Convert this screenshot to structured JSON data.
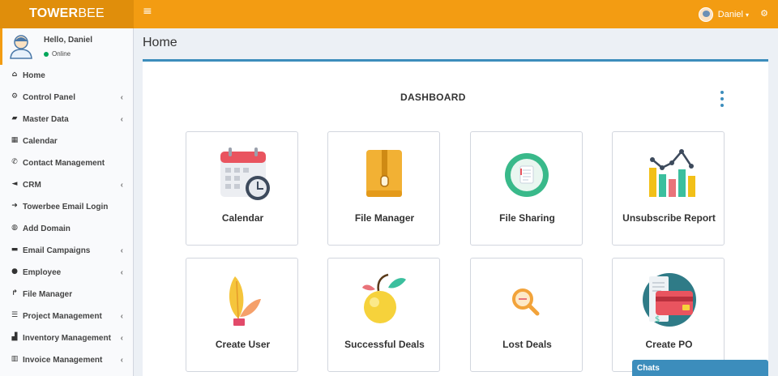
{
  "header": {
    "logo_bold": "TOWER",
    "logo_rest": "BEE",
    "user_name": "Daniel",
    "toggle_glyph": "≡",
    "settings_glyph": "⚙",
    "colors": {
      "bar": "#f39c12",
      "logo_bg": "#e08e0b"
    }
  },
  "sidebar": {
    "greeting": "Hello, Daniel",
    "status": "Online",
    "items": [
      {
        "label": "Home",
        "icon": "home-icon",
        "glyph": "⌂",
        "expandable": false
      },
      {
        "label": "Control Panel",
        "icon": "gear-icon",
        "glyph": "⚙",
        "expandable": true
      },
      {
        "label": "Master Data",
        "icon": "book-icon",
        "glyph": "▰",
        "expandable": true
      },
      {
        "label": "Calendar",
        "icon": "calendar-icon",
        "glyph": "▦",
        "expandable": false
      },
      {
        "label": "Contact Management",
        "icon": "phone-icon",
        "glyph": "✆",
        "expandable": false
      },
      {
        "label": "CRM",
        "icon": "bullhorn-icon",
        "glyph": "◄",
        "expandable": true
      },
      {
        "label": "Towerbee Email Login",
        "icon": "sign-in-icon",
        "glyph": "➜",
        "expandable": false
      },
      {
        "label": "Add Domain",
        "icon": "globe-icon",
        "glyph": "◍",
        "expandable": false
      },
      {
        "label": "Email Campaigns",
        "icon": "folder-icon",
        "glyph": "▬",
        "expandable": true
      },
      {
        "label": "Employee",
        "icon": "user-icon",
        "glyph": "●",
        "expandable": true
      },
      {
        "label": "File Manager",
        "icon": "share-icon",
        "glyph": "↱",
        "expandable": false
      },
      {
        "label": "Project Management",
        "icon": "tasks-icon",
        "glyph": "☰",
        "expandable": true
      },
      {
        "label": "Inventory Management",
        "icon": "industry-icon",
        "glyph": "▟",
        "expandable": true
      },
      {
        "label": "Invoice Management",
        "icon": "bank-icon",
        "glyph": "▥",
        "expandable": true
      }
    ],
    "chevron": "‹"
  },
  "main": {
    "page_title": "Home",
    "box_title": "DASHBOARD",
    "cards": [
      {
        "title": "Calendar",
        "icon": "calendar-clock-icon"
      },
      {
        "title": "File Manager",
        "icon": "zip-folder-icon"
      },
      {
        "title": "File Sharing",
        "icon": "shared-document-icon"
      },
      {
        "title": "Unsubscribe Report",
        "icon": "bar-chart-icon"
      },
      {
        "title": "Create User",
        "icon": "plant-pot-icon"
      },
      {
        "title": "Successful Deals",
        "icon": "fruit-icon"
      },
      {
        "title": "Lost Deals",
        "icon": "magnifier-icon"
      },
      {
        "title": "Create PO",
        "icon": "receipt-card-icon"
      }
    ]
  },
  "chats": {
    "label": "Chats"
  }
}
